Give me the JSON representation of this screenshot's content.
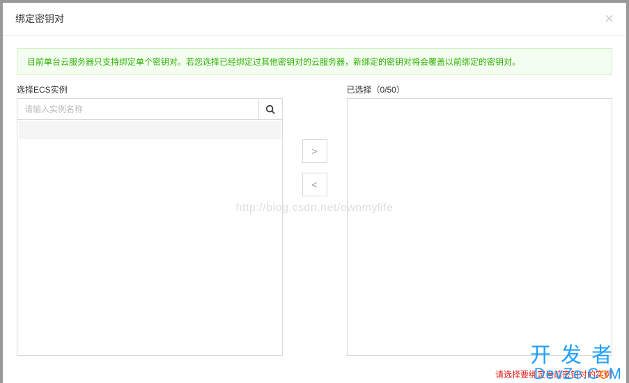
{
  "modal": {
    "title": "绑定密钥对"
  },
  "alert": {
    "text": "目前单台云服务器只支持绑定单个密钥对。若您选择已经绑定过其他密钥对的云服务器，新绑定的密钥对将会覆盖以前绑定的密钥对。"
  },
  "left": {
    "label": "选择ECS实例",
    "search_placeholder": "请输入实例名称"
  },
  "right": {
    "label": "已选择（0/50）"
  },
  "transfer": {
    "add": ">",
    "remove": "<"
  },
  "watermark": "http://blog.csdn.net/ownmylife",
  "error": "请选择要绑定当前密钥对的实例",
  "brand": {
    "line1": "开发者",
    "line2_pre": "DevZe.C",
    "line2_o": "o",
    "line2_post": "M"
  }
}
